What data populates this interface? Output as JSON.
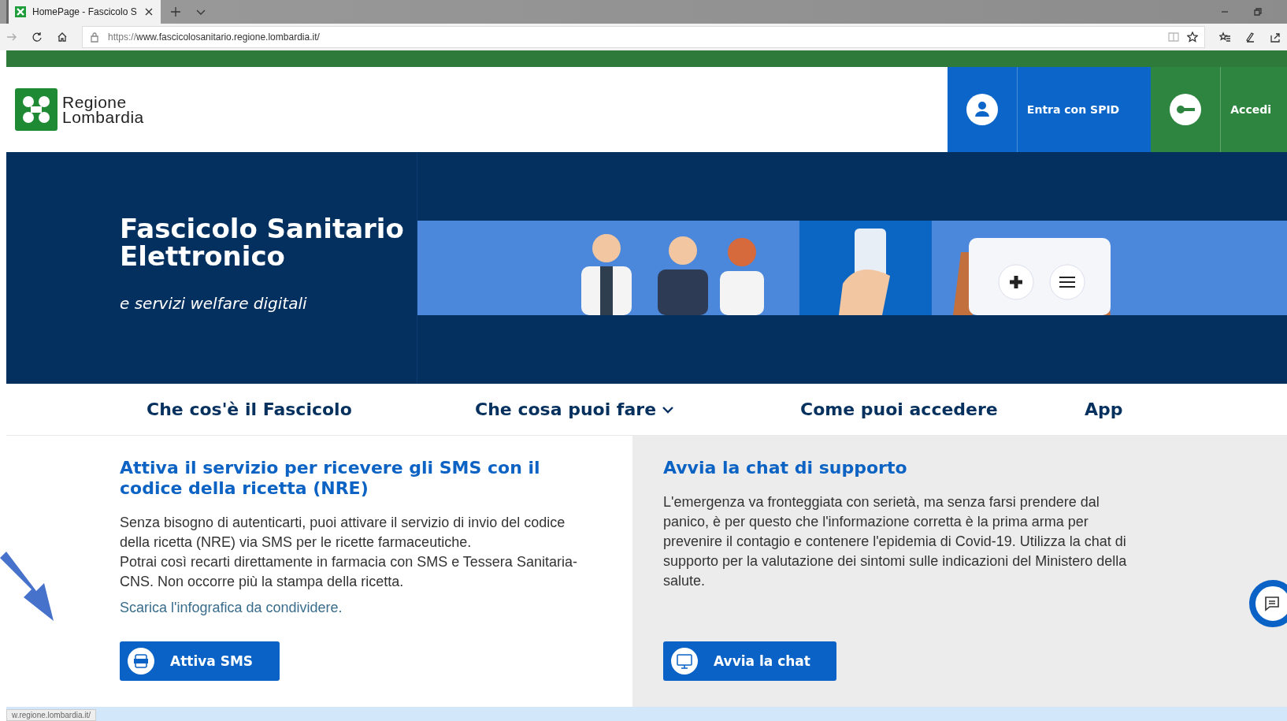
{
  "browser": {
    "tab_title": "HomePage - Fascicolo S",
    "url_prefix": "https://",
    "url_host": "www.fascicolosanitario.regione.lombardia.it/"
  },
  "header": {
    "logo_lines": [
      "Regione",
      "Lombardia"
    ],
    "buttons": [
      {
        "label": "Entra con SPID",
        "kind": "spid"
      },
      {
        "label": "Accedi",
        "kind": "login"
      }
    ]
  },
  "hero": {
    "title": "Fascicolo Sanitario Elettronico",
    "subtitle": "e servizi welfare digitali"
  },
  "nav": [
    {
      "label": "Che cos'è il Fascicolo",
      "dropdown": false
    },
    {
      "label": "Che cosa puoi fare",
      "dropdown": true
    },
    {
      "label": "Come puoi accedere",
      "dropdown": false
    },
    {
      "label": "App",
      "dropdown": false
    }
  ],
  "cards": [
    {
      "title": "Attiva il servizio per ricevere gli SMS con il codice della ricetta (NRE)",
      "paragraphs": [
        "Senza bisogno di autenticarti, puoi attivare il servizio di invio del codice della ricetta (NRE) via SMS per le ricette farmaceutiche.",
        "Potrai così recarti direttamente in farmacia con SMS e Tessera Sanitaria-CNS. Non occorre più la stampa della ricetta."
      ],
      "link": "Scarica l'infografica da condividere.",
      "button": "Attiva SMS",
      "kind": "sms"
    },
    {
      "title": "Avvia la chat di supporto",
      "paragraphs": [
        "L'emergenza va fronteggiata con serietà, ma senza farsi prendere dal panico, è per questo che l'informazione corretta è la prima arma per prevenire il contagio e contenere l'epidemia di Covid-19. Utilizza la chat di supporto per la valutazione dei sintomi sulle indicazioni del Ministero della salute."
      ],
      "button": "Avvia la chat",
      "kind": "chat"
    }
  ],
  "status_text": "w.regione.lombardia.it/"
}
